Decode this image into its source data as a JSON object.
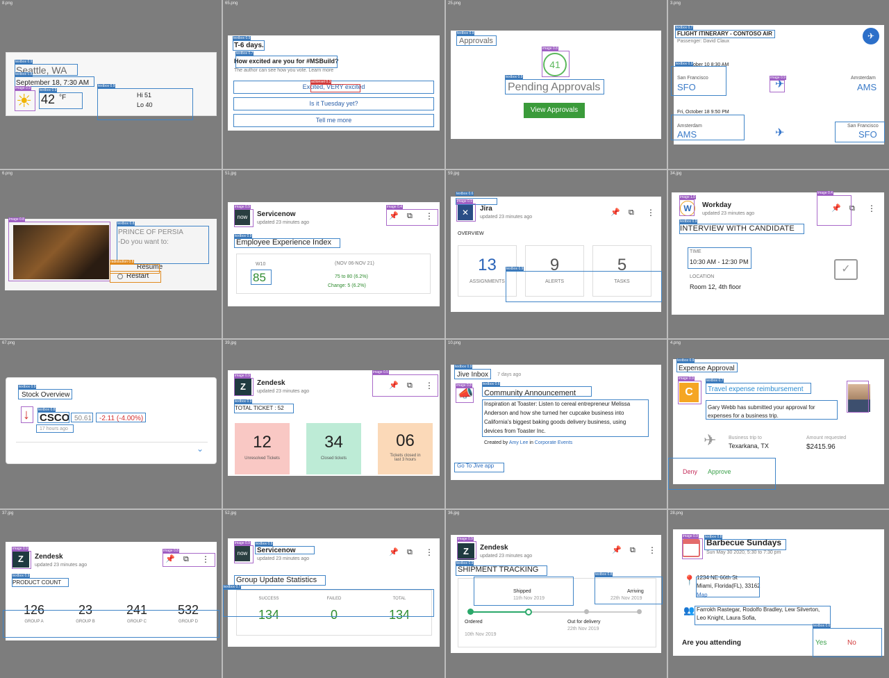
{
  "cells": {
    "c1": {
      "file": "8.png",
      "city": "Seattle, WA",
      "date": "September 18, 7:30 AM",
      "temp": "42",
      "unit": "°F",
      "hi": "Hi 51",
      "lo": "Lo 40",
      "tags": {
        "city": "textbox 0.9",
        "date": "textbox 0.8",
        "img": "image 0.9",
        "temp": "textbox 0.9",
        "unit": "textbox 0.8",
        "hilo": "textbox 0.9"
      }
    },
    "c2": {
      "file": "65.png",
      "heading": "T-6 days.",
      "question": "How excited are you for #MSBuild?",
      "note": "The author can see how you vote. Learn more",
      "opt1": "Excited, VERY excited",
      "opt2": "Is it Tuesday yet?",
      "opt3": "Tell me more",
      "tags": {
        "a": "textbox 0.9",
        "b": "textbox 0.7",
        "c": "actionset 0.3"
      }
    },
    "c3": {
      "file": "25.png",
      "title": "Approvals",
      "count": "41",
      "label": "Pending Approvals",
      "button": "View Approvals",
      "tags": {
        "a": "textbox 0.9",
        "b": "image 0.8",
        "c": "textbox 0.9"
      }
    },
    "c4": {
      "file": "3.png",
      "title": "FLIGHT ITINERARY - CONTOSO AIR",
      "passenger": "Passenger: David Claux",
      "dep1": "Fri, October 10 8:30 AM",
      "from1": "San Francisco",
      "code1": "SFO",
      "to1": "Amsterdam",
      "code2": "AMS",
      "dep2": "Fri, October 18 9:50 PM",
      "from2": "Amsterdam",
      "code3": "AMS",
      "to2": "San Francisco",
      "code4": "SFO",
      "tags": {
        "a": "textbox 0.7",
        "b": "textbox 0.9",
        "c": "image 0.9"
      }
    },
    "c5": {
      "file": "6.png",
      "title": "PRINCE OF PERSIA",
      "prompt": "-Do you want to:",
      "resume": "Resume",
      "restart": "Restart",
      "tags": {
        "a": "image 0.8",
        "b": "textbox 0.8",
        "c": "radiobutton 0.8"
      }
    },
    "c6": {
      "file": "51.jpg",
      "app": "Servicenow",
      "updated": "updated 23 minutes ago",
      "section": "Employee Experience Index",
      "sub": "W10",
      "score": "85",
      "range": "(NOV 06-NOV 21)",
      "trend": "75 to 80 (6.2%)",
      "change": "Change: 5 (6.2%)",
      "tags": {
        "a": "image 0.9",
        "b": "textbox 0.9",
        "c": "image 0.4"
      }
    },
    "c7": {
      "file": "59.jpg",
      "app": "Jira",
      "updated": "updated 23 minutes ago",
      "overview": "OVERVIEW",
      "n1": "13",
      "l1": "ASSIGNMENTS",
      "n2": "9",
      "l2": "ALERTS",
      "n3": "5",
      "l3": "TASKS",
      "tags": {
        "a": "textbox 0.6",
        "b": "image 0.9",
        "c": "textbox 0.9"
      }
    },
    "c8": {
      "file": "34.jpg",
      "app": "Workday",
      "updated": "updated 23 minutes ago",
      "title": "INTERVIEW WITH CANDIDATE",
      "timeLabel": "TIME",
      "time": "10:30 AM - 12:30 PM",
      "locLabel": "LOCATION",
      "location": "Room 12, 4th floor",
      "tags": {
        "a": "image 1.0",
        "b": "textbox 0.9",
        "c": "image 0.4"
      }
    },
    "c9": {
      "file": "67.png",
      "title": "Stock Overview",
      "ticker": "CSCO",
      "price": "50.61",
      "change": "-2.11 (-4.00%)",
      "ago": "17 hours ago",
      "tags": {
        "a": "textbox 0.9",
        "b": "image 0.8",
        "c": "textbox 0.8"
      }
    },
    "c10": {
      "file": "39.jpg",
      "app": "Zendesk",
      "updated": "updated 23 minutes ago",
      "total": "TOTAL TICKET : 52",
      "n1": "12",
      "l1": "Unresolved Tickets",
      "n2": "34",
      "l2": "Closed tickets",
      "n3": "06",
      "l3": "Tickets closed in last 3 hours",
      "tags": {
        "a": "image 0.9",
        "b": "textbox 0.9",
        "c": "image 0.5"
      }
    },
    "c11": {
      "file": "10.png",
      "app": "Jive Inbox",
      "ago": "7 days ago",
      "title": "Community Announcement",
      "body1": "Inspiration at Toaster: Listen to cereal entrepreneur Melissa",
      "body2": "Anderson and how she turned her cupcake business into",
      "body3": "California's biggest baking goods delivery business, using",
      "body4": "devices from Toaster Inc.",
      "createdBy": "Created by",
      "author": "Amy Lee",
      "in": "in",
      "group": "Corporate Events",
      "link": "Go To Jive app",
      "tags": {
        "a": "textbox 0.9",
        "b": "textbox 0.6",
        "c": "image 0.8"
      }
    },
    "c12": {
      "file": "4.png",
      "title": "Expense Approval",
      "sub": "Travel expense reimbursement",
      "desc1": "Gary Webb has submitted your approval for",
      "desc2": "expenses for a business trip.",
      "tripLabel": "Business trip to",
      "trip": "Texarkana, TX",
      "amtLabel": "Amount requested",
      "amount": "$2415.96",
      "deny": "Deny",
      "approve": "Approve",
      "tags": {
        "a": "textbox 0.9",
        "b": "image 0.9",
        "c": "textbox 0.7"
      }
    },
    "c13": {
      "file": "37.jpg",
      "app": "Zendesk",
      "updated": "updated 23 minutes ago",
      "section": "PRODUCT COUNT",
      "n1": "126",
      "l1": "GROUP A",
      "n2": "23",
      "l2": "GROUP B",
      "n3": "241",
      "l3": "GROUP C",
      "n4": "532",
      "l4": "GROUP D",
      "tags": {
        "a": "image 0.9",
        "b": "textbox 0.9",
        "c": "image 0.8"
      }
    },
    "c14": {
      "file": "52.jpg",
      "app": "Servicenow",
      "updated": "updated 23 minutes ago",
      "section": "Group Update Statistics",
      "l1": "SUCCESS",
      "n1": "134",
      "l2": "FAILED",
      "n2": "0",
      "l3": "TOTAL",
      "n3": "134",
      "tags": {
        "a": "image 0.9",
        "b": "textbox 0.9",
        "c": "textbox 0.7"
      }
    },
    "c15": {
      "file": "36.jpg",
      "app": "Zendesk",
      "updated": "updated 23 minutes ago",
      "section": "SHIPMENT TRACKING",
      "s1": "Shipped",
      "d1": "11th Nov 2019",
      "s2": "Arriving",
      "d2": "22th Nov 2019",
      "s3": "Ordered",
      "d3": "10th Nov 2019",
      "s4": "Out for delivery",
      "d4": "22th Nov 2019",
      "tags": {
        "a": "image 0.9",
        "b": "textbox 0.9",
        "c": "textbox 0.8"
      }
    },
    "c16": {
      "file": "28.png",
      "title": "Barbecue Sundays",
      "when": "Sun May 30 2020, 5:30 to 7:30 pm",
      "addr1": "1234 NE 66th St",
      "addr2": "Miami, Florida(FL), 33162",
      "map": "Map",
      "people1": "Farrokh Rastegar, Rodolfo Bradley, Lew Silverton,",
      "people2": "Leo Knight, Laura Sofia,",
      "question": "Are you attending",
      "yes": "Yes",
      "no": "No",
      "tags": {
        "a": "image 0.9",
        "b": "textbox 0.8",
        "c": "textbox 0.6"
      }
    }
  }
}
